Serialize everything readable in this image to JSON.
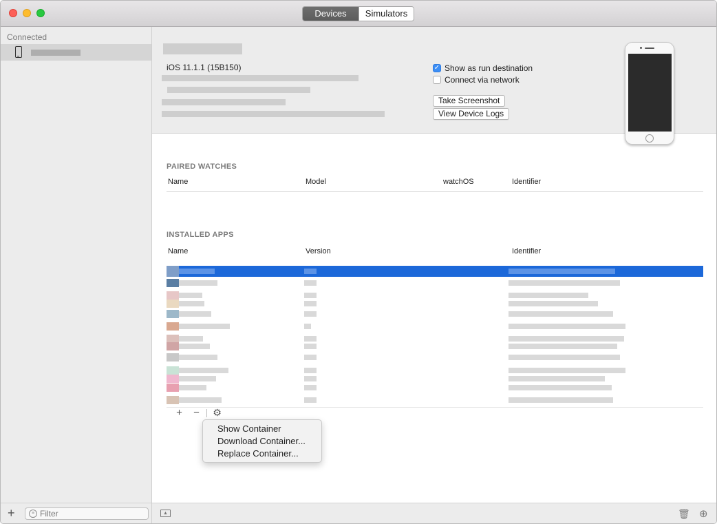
{
  "window": {
    "tabs": [
      {
        "label": "Devices",
        "active": true
      },
      {
        "label": "Simulators",
        "active": false
      }
    ]
  },
  "sidebar": {
    "section_title": "Connected",
    "filter_placeholder": "Filter"
  },
  "device": {
    "ios_version": "iOS 11.1.1 (15B150)",
    "checkboxes": [
      {
        "label": "Show as run destination",
        "checked": true
      },
      {
        "label": "Connect via network",
        "checked": false
      }
    ],
    "buttons": {
      "screenshot": "Take Screenshot",
      "logs": "View Device Logs"
    }
  },
  "paired_watches": {
    "title": "PAIRED WATCHES",
    "columns": [
      "Name",
      "Model",
      "watchOS",
      "Identifier"
    ]
  },
  "installed_apps": {
    "title": "INSTALLED APPS",
    "columns": [
      "Name",
      "Version",
      "Identifier"
    ],
    "selected_row_color": "#1c68d9"
  },
  "context_menu": {
    "items": [
      "Show Container",
      "Download Container...",
      "Replace Container..."
    ]
  },
  "icons": {
    "add": "+",
    "remove": "−",
    "gear": "⚙",
    "trash": "🗑",
    "download": "⊕"
  }
}
